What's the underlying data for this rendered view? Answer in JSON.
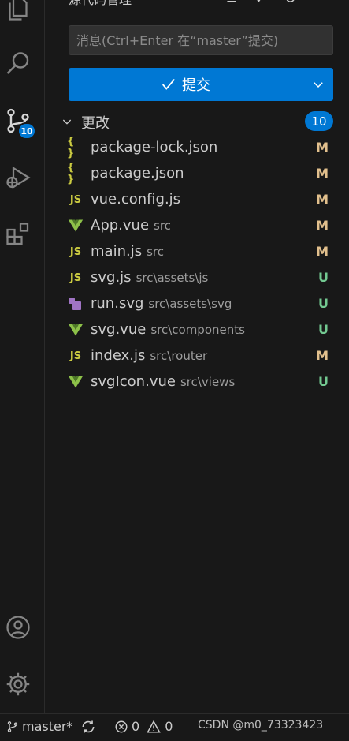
{
  "colors": {
    "accent": "#0078d4",
    "modified": "#e2c08d",
    "untracked": "#73c991",
    "json": "#cbcb41",
    "js": "#cbcb41",
    "vue": "#8dc149",
    "svg": "#a074c4"
  },
  "activity_bar": {
    "items": [
      {
        "name": "explorer",
        "icon": "files-icon"
      },
      {
        "name": "search",
        "icon": "search-icon"
      },
      {
        "name": "source-control",
        "icon": "source-control-icon",
        "badge": "10"
      },
      {
        "name": "run-debug",
        "icon": "run-debug-icon"
      },
      {
        "name": "extensions",
        "icon": "extensions-icon"
      }
    ],
    "bottom": [
      {
        "name": "accounts",
        "icon": "account-icon"
      },
      {
        "name": "manage",
        "icon": "gear-icon"
      }
    ]
  },
  "sidebar": {
    "title": "源代码管理",
    "message_placeholder": "消息(Ctrl+Enter 在“master”提交)",
    "commit_label": "提交",
    "section_label": "更改",
    "changes_count": "10",
    "files": [
      {
        "name": "package-lock.json",
        "dir": "",
        "status": "M",
        "type": "json"
      },
      {
        "name": "package.json",
        "dir": "",
        "status": "M",
        "type": "json"
      },
      {
        "name": "vue.config.js",
        "dir": "",
        "status": "M",
        "type": "js"
      },
      {
        "name": "App.vue",
        "dir": "src",
        "status": "M",
        "type": "vue"
      },
      {
        "name": "main.js",
        "dir": "src",
        "status": "M",
        "type": "js"
      },
      {
        "name": "svg.js",
        "dir": "src\\assets\\js",
        "status": "U",
        "type": "js"
      },
      {
        "name": "run.svg",
        "dir": "src\\assets\\svg",
        "status": "U",
        "type": "svg"
      },
      {
        "name": "svg.vue",
        "dir": "src\\components",
        "status": "U",
        "type": "vue"
      },
      {
        "name": "index.js",
        "dir": "src\\router",
        "status": "M",
        "type": "js"
      },
      {
        "name": "svgIcon.vue",
        "dir": "src\\views",
        "status": "U",
        "type": "vue"
      }
    ]
  },
  "status_bar": {
    "branch": "master*",
    "errors": "0",
    "warnings": "0",
    "watermark": "CSDN @m0_73323423"
  }
}
